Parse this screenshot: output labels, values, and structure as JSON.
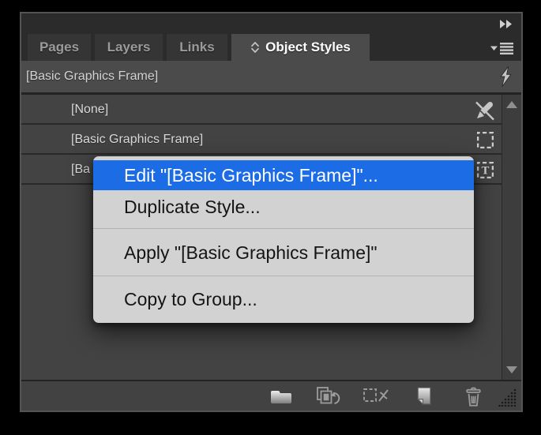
{
  "panel": {
    "tabs": [
      {
        "label": "Pages",
        "active": false
      },
      {
        "label": "Layers",
        "active": false
      },
      {
        "label": "Links",
        "active": false
      },
      {
        "label": "Object Styles",
        "active": true,
        "icon": "diamond"
      }
    ],
    "applied_style": "[Basic Graphics Frame]",
    "styles": [
      {
        "label": "[None]",
        "icon": "pen-slash"
      },
      {
        "label": "[Basic Graphics Frame]",
        "icon": "dashed-frame"
      },
      {
        "label": "[Ba",
        "icon": "dashed-frame-T"
      }
    ]
  },
  "context_menu": {
    "items": [
      {
        "label": "Edit \"[Basic Graphics Frame]\"...",
        "highlighted": true
      },
      {
        "label": "Duplicate Style...",
        "highlighted": false
      },
      {
        "label": "Apply \"[Basic Graphics Frame]\"",
        "highlighted": false
      },
      {
        "label": "Copy to Group...",
        "highlighted": false
      }
    ]
  },
  "icons": {
    "collapse": "double-chevron-right",
    "panel_menu": "triangle-hamburger",
    "quick_apply": "lightning-bolt",
    "toolbar": [
      "style-group-folder",
      "clear-overrides",
      "clear-attributes-not-defined",
      "create-new-style",
      "delete-style"
    ],
    "resize": "grip-dots"
  },
  "colors": {
    "highlight_blue": "#1b6ce5",
    "menu_bg": "#d2d2d2",
    "panel_body": "#434343",
    "panel_chrome": "#2b2b2b",
    "active_tab": "#4b4b4b",
    "outer_bg": "#000000"
  }
}
